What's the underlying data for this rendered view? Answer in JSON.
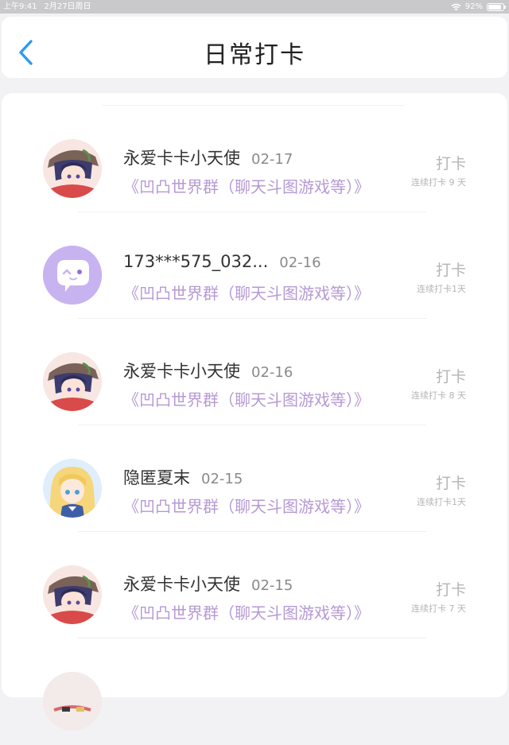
{
  "status_bar": {
    "time": "上午9:41",
    "date": "2月27日周日",
    "battery": "92%",
    "battery_level": 0.92
  },
  "header": {
    "title": "日常打卡",
    "back_icon": "chevron-left-icon",
    "accent_color": "#2d9af2"
  },
  "theme": {
    "group_text_color": "#b699d4",
    "muted_text_color": "#b5b5b5"
  },
  "checkins": [
    {
      "username": "永爱卡卡小天使",
      "date": "02-17",
      "group": "《凹凸世界群（聊天斗图游戏等）》",
      "action": "打卡",
      "streak": "连续打卡 9 天",
      "avatar": "anime-boy-avatar"
    },
    {
      "username": "173***575_032...",
      "date": "02-16",
      "group": "《凹凸世界群（聊天斗图游戏等）》",
      "action": "打卡",
      "streak": "连续打卡1天",
      "avatar": "chat-bubble-avatar"
    },
    {
      "username": "永爱卡卡小天使",
      "date": "02-16",
      "group": "《凹凸世界群（聊天斗图游戏等）》",
      "action": "打卡",
      "streak": "连续打卡 8 天",
      "avatar": "anime-boy-avatar"
    },
    {
      "username": "隐匿夏末",
      "date": "02-15",
      "group": "《凹凸世界群（聊天斗图游戏等）》",
      "action": "打卡",
      "streak": "连续打卡1天",
      "avatar": "anime-girl-avatar"
    },
    {
      "username": "永爱卡卡小天使",
      "date": "02-15",
      "group": "《凹凸世界群（聊天斗图游戏等）》",
      "action": "打卡",
      "streak": "连续打卡 7 天",
      "avatar": "anime-boy-avatar"
    }
  ]
}
